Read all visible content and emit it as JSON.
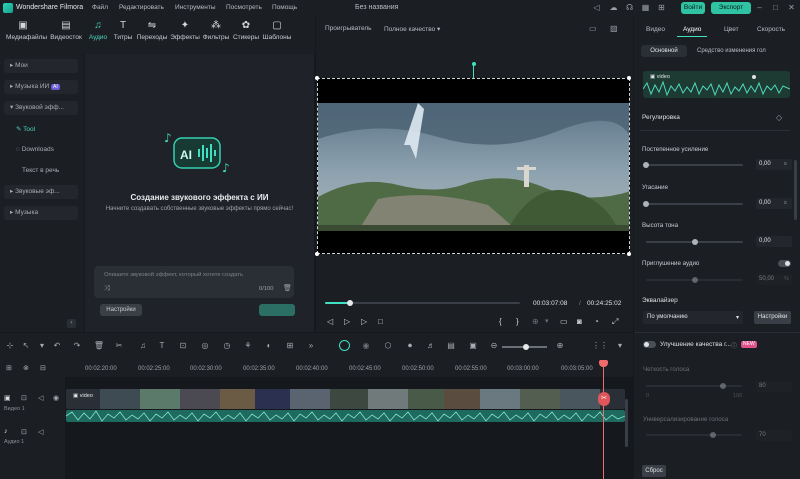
{
  "app": {
    "name": "Wondershare Filmora",
    "document_title": "Без названия"
  },
  "menu": [
    "Файл",
    "Редактировать",
    "Инструменты",
    "Посмотреть",
    "Помощь"
  ],
  "header_buttons": {
    "login": "Войти",
    "export": "Экспорт"
  },
  "toolbar": {
    "tools": [
      {
        "label": "Медиафайлы",
        "icon": "media-icon"
      },
      {
        "label": "Видеосток",
        "icon": "stock-video-icon"
      },
      {
        "label": "Аудио",
        "icon": "music-note-icon",
        "active": true
      },
      {
        "label": "Титры",
        "icon": "text-icon"
      },
      {
        "label": "Переходы",
        "icon": "transition-icon"
      },
      {
        "label": "Эффекты",
        "icon": "effects-icon"
      },
      {
        "label": "Фильтры",
        "icon": "filters-icon"
      },
      {
        "label": "Стикеры",
        "icon": "stickers-icon"
      },
      {
        "label": "Шаблоны",
        "icon": "templates-icon"
      }
    ]
  },
  "left_nav": {
    "items": [
      "Мои",
      "Музыка ИИ",
      "Звуковой эфф...",
      "Звуковые эф...",
      "Музыка"
    ],
    "ai_badge": "AI",
    "sub_items": [
      "Tool",
      "Downloads",
      "Текст в речь"
    ]
  },
  "ai_panel": {
    "title": "Создание звукового эффекта с ИИ",
    "subtitle": "Начните создавать собственные звуковые эффекты прямо сейчас!",
    "prompt_placeholder": "Опишите звуковой эффект, который хотите создать",
    "counter": "0/100",
    "settings_button": "Настройки"
  },
  "preview": {
    "player_label": "Проигрыватель",
    "quality": "Полное качество",
    "current_time": "00:03:07:08",
    "total_time": "00:24:25:02",
    "progress": 0.13
  },
  "right_panel": {
    "tabs": [
      "Видео",
      "Аудио",
      "Цвет",
      "Скорость"
    ],
    "active_tab": "Аудио",
    "subtabs": [
      "Основной",
      "Средство изменения гол"
    ],
    "clip_label": "video",
    "sections": {
      "adjust": "Регулировка",
      "equalizer": "Эквалайзер",
      "enhance": "Улучшение качества г...",
      "enhance_badge": "NEW"
    },
    "params": [
      {
        "label": "Постепенное усиление",
        "value": "0,00",
        "unit": "s",
        "level": 0.0
      },
      {
        "label": "Угасание",
        "value": "0,00",
        "unit": "s",
        "level": 0.0
      },
      {
        "label": "Высота тона",
        "value": "0,00",
        "unit": "",
        "level": 0.5
      }
    ],
    "ducking": {
      "label": "Приглушение аудио",
      "value": "50,00",
      "unit": "%",
      "level": 0.5
    },
    "equalizer_preset": "По умолчанию",
    "equalizer_settings": "Настройки",
    "enhance_params": [
      {
        "label": "Четкость голоса",
        "value": "80",
        "level": 0.8,
        "min": "0",
        "max": "100"
      },
      {
        "label": "Универсализирование голоса",
        "value": "70",
        "level": 0.7
      }
    ],
    "reset": "Сброс"
  },
  "timeline": {
    "ticks": [
      "00:02:20:00",
      "00:02:25:00",
      "00:02:30:00",
      "00:02:35:00",
      "00:02:40:00",
      "00:02:45:00",
      "00:02:50:00",
      "00:02:55:00",
      "00:03:00:00",
      "00:03:05:00"
    ],
    "video_track": "Видео 1",
    "audio_track": "Аудио 1",
    "clip_name": "video"
  },
  "colors": {
    "accent": "#2fc3a3",
    "playhead": "#f26b6b",
    "audio_clip": "#1f6a5e"
  }
}
